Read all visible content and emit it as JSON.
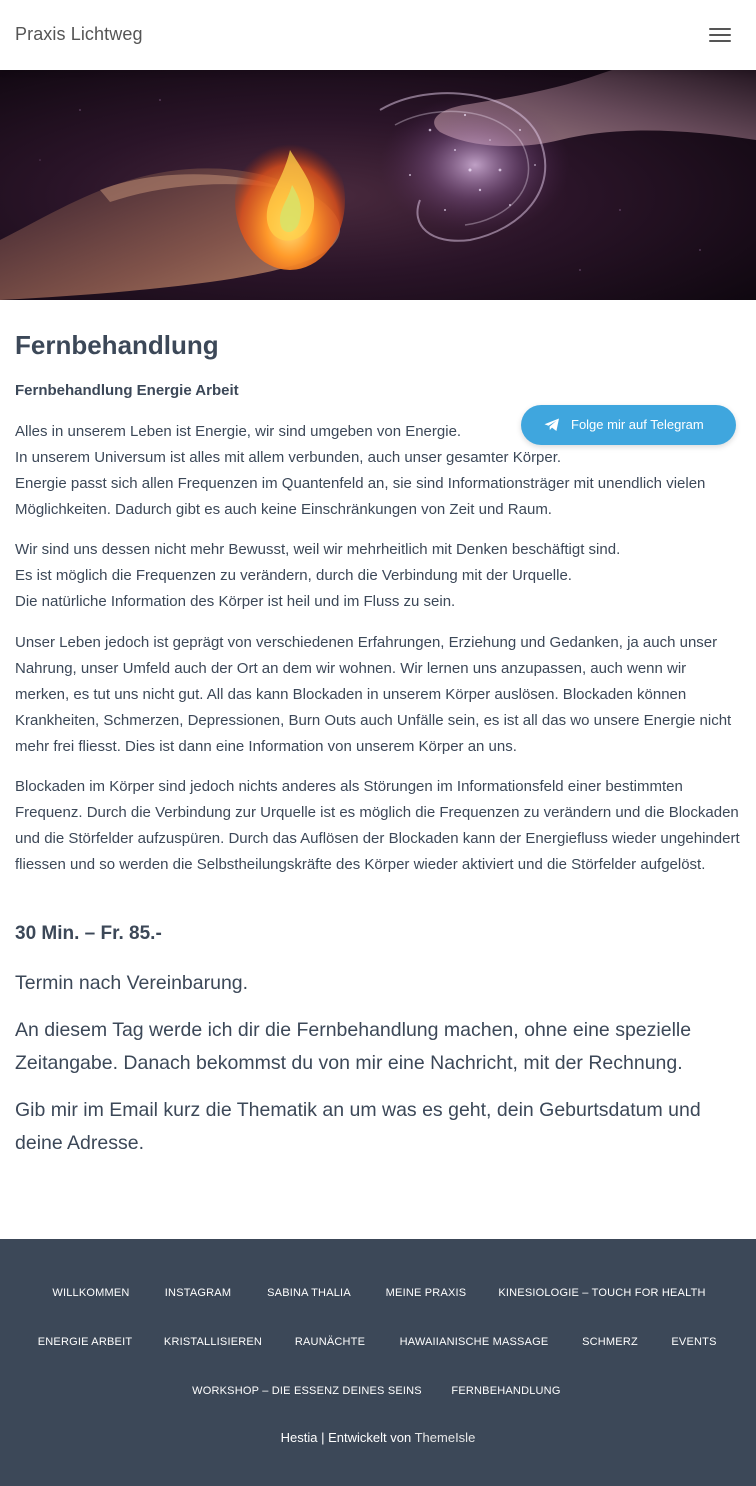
{
  "header": {
    "site_title": "Praxis Lichtweg",
    "menu_icon": "hamburger-menu-icon"
  },
  "hero": {
    "image": "hands-with-flame-and-energy-swirl"
  },
  "article": {
    "title": "Fernbehandlung",
    "subtitle": "Fernbehandlung Energie Arbeit",
    "paragraphs": [
      [
        "Alles in unserem Leben ist Energie, wir sind umgeben von Energie.",
        "In unserem Universum ist alles mit allem verbunden, auch unser gesamter Körper.",
        "Energie passt sich allen Frequenzen im Quantenfeld an, sie sind Informationsträger mit unendlich vielen Möglichkeiten. Dadurch gibt es auch keine Einschränkungen von Zeit und Raum."
      ],
      [
        "Wir sind uns dessen nicht mehr Bewusst, weil wir mehrheitlich mit Denken beschäftigt sind.",
        "Es ist möglich die Frequenzen zu verändern, durch die Verbindung mit der Urquelle.",
        "Die natürliche Information des Körper ist heil und im Fluss zu sein."
      ],
      [
        "Unser Leben jedoch ist geprägt von verschiedenen Erfahrungen, Erziehung und Gedanken, ja auch unser Nahrung, unser Umfeld auch der Ort an dem wir wohnen. Wir lernen uns anzupassen, auch wenn wir merken, es tut uns nicht gut. All das kann Blockaden in unserem Körper auslösen. Blockaden können Krankheiten, Schmerzen, Depressionen, Burn Outs auch Unfälle sein, es ist all das wo unsere Energie nicht mehr frei fliesst. Dies ist dann eine Information von unserem Körper an uns."
      ],
      [
        "Blockaden im Körper sind jedoch nichts anderes als Störungen im Informationsfeld einer bestimmten Frequenz. Durch die Verbindung zur Urquelle ist es möglich die Frequenzen zu verändern und die Blockaden und die Störfelder aufzuspüren. Durch das Auflösen der Blockaden kann der Energiefluss wieder ungehindert fliessen und so werden die Selbstheilungskräfte des Körper wieder aktiviert und die Störfelder aufgelöst."
      ]
    ],
    "price": "30 Min. – Fr. 85.-",
    "appointment": "Termin nach Vereinbarung.",
    "info_1": "An diesem Tag werde ich dir die Fernbehandlung machen, ohne eine spezielle Zeitangabe. Danach bekommst du von mir eine Nachricht, mit der Rechnung.",
    "info_2": "Gib mir im Email kurz die Thematik an um was es geht, dein Geburtsdatum und deine Adresse."
  },
  "telegram_button": {
    "label": "Folge mir auf Telegram",
    "icon": "telegram-paper-plane-icon",
    "color": "#3fa6de"
  },
  "footer": {
    "nav": [
      "WILLKOMMEN",
      "INSTAGRAM",
      "SABINA THALIA",
      "MEINE PRAXIS",
      "KINESIOLOGIE – TOUCH FOR HEALTH",
      "ENERGIE ARBEIT",
      "KRISTALLISIEREN",
      "RAUNÄCHTE",
      "HAWAIIANISCHE MASSAGE",
      "SCHMERZ",
      "EVENTS",
      "WORKSHOP – DIE ESSENZ DEINES SEINS",
      "FERNBEHANDLUNG"
    ],
    "credit_prefix": "Hestia | Entwickelt von",
    "credit_link": "ThemeIsle",
    "background": "#3c4858"
  }
}
